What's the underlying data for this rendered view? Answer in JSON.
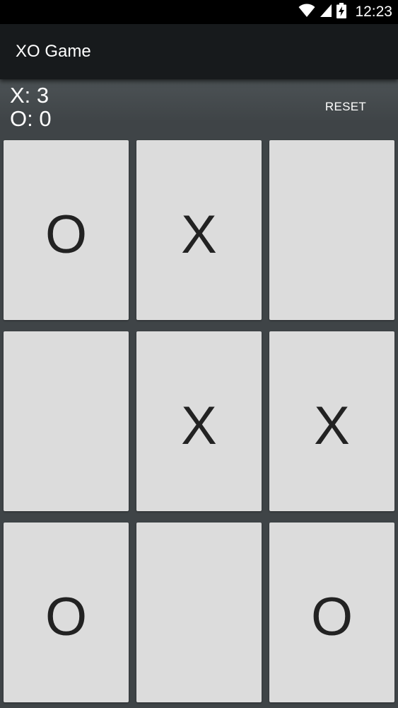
{
  "status_bar": {
    "time": "12:23",
    "icons": [
      "wifi-icon",
      "signal-icon",
      "battery-charging-icon"
    ]
  },
  "app_bar": {
    "title": "XO Game"
  },
  "scoreboard": {
    "x_score": "X: 3",
    "o_score": "O: 0"
  },
  "toolbar": {
    "reset_label": "RESET"
  },
  "board": {
    "cells": [
      "O",
      "X",
      "",
      "",
      "X",
      "X",
      "O",
      "",
      "O"
    ]
  },
  "colors": {
    "status_bar_bg": "#000000",
    "app_bar_bg": "#171a1c",
    "content_bg": "#3f4447",
    "cell_bg": "#dcdcdc",
    "mark_color": "#222222"
  }
}
